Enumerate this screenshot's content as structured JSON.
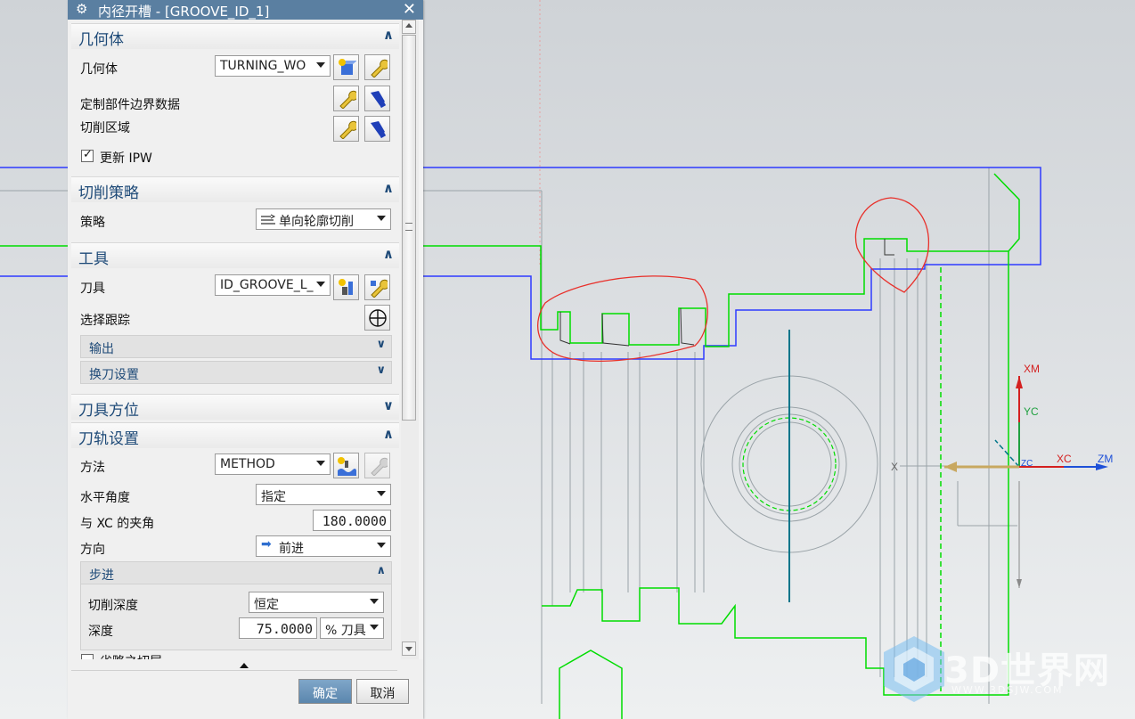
{
  "dialog": {
    "title": "内径开槽 - [GROOVE_ID_1]",
    "close_glyph": "✕",
    "gear_glyph": "⚙"
  },
  "geometry": {
    "header": "几何体",
    "geometry_label": "几何体",
    "geometry_value": "TURNING_WO",
    "custom_boundary_label": "定制部件边界数据",
    "cut_region_label": "切削区域",
    "update_ipw_label": "更新 IPW",
    "update_ipw_checked": true
  },
  "strategy": {
    "header": "切削策略",
    "strategy_label": "策略",
    "strategy_value": "单向轮廓切削"
  },
  "tool": {
    "header": "工具",
    "tool_label": "刀具",
    "tool_value": "ID_GROOVE_L_",
    "tracking_label": "选择跟踪",
    "output_label": "输出",
    "tool_change_label": "换刀设置"
  },
  "tool_orientation": {
    "header": "刀具方位"
  },
  "path_settings": {
    "header": "刀轨设置",
    "method_label": "方法",
    "method_value": "METHOD",
    "horizontal_angle_label": "水平角度",
    "horizontal_angle_value": "指定",
    "xc_angle_label": "与 XC 的夹角",
    "xc_angle_value": "180.0000",
    "direction_label": "方向",
    "direction_value": "前进",
    "stepover": {
      "header": "步进",
      "cut_depth_label": "切削深度",
      "cut_depth_value": "恒定",
      "depth_label": "深度",
      "depth_value": "75.0000",
      "depth_unit": "% 刀具"
    },
    "clipped_next_label": "省略之切层"
  },
  "buttons": {
    "ok": "确定",
    "cancel": "取消"
  },
  "viewport": {
    "axis_labels": {
      "xm": "XM",
      "yc": "YC",
      "xc": "XC",
      "zm": "ZM",
      "zc": "ZC",
      "x": "X"
    },
    "colors": {
      "stock_outline": "#2e3bff",
      "part_outline": "#00dd00",
      "annotation": "#e8302a",
      "axis": "#00758a"
    }
  },
  "watermark": {
    "brand": "3D世界网",
    "url": "WWW.3DSJW.COM"
  }
}
